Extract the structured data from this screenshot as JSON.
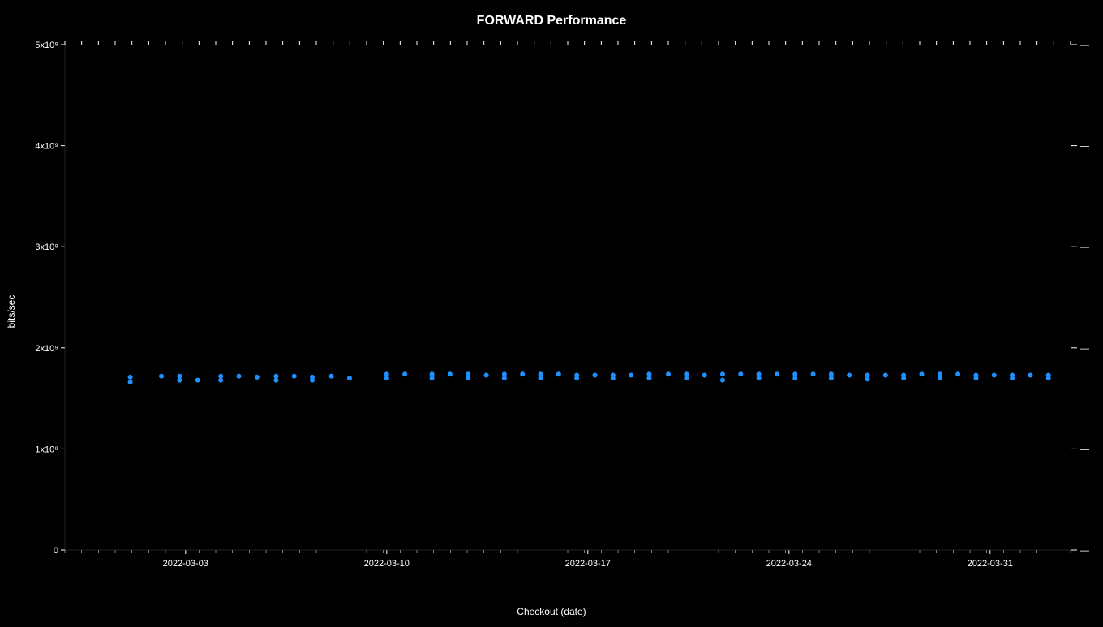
{
  "chart": {
    "title": "FORWARD Performance",
    "x_axis_label": "Checkout (date)",
    "y_axis_label": "bits/sec",
    "y_ticks": [
      {
        "label": "0",
        "value": 0
      },
      {
        "label": "1x10⁹",
        "value": 1
      },
      {
        "label": "2x10⁹",
        "value": 2
      },
      {
        "label": "3x10⁹",
        "value": 3
      },
      {
        "label": "4x10⁹",
        "value": 4
      },
      {
        "label": "5x10⁹",
        "value": 5
      }
    ],
    "x_ticks": [
      {
        "label": "2022-03-03",
        "xpos": 0.12
      },
      {
        "label": "2022-03-10",
        "xpos": 0.32
      },
      {
        "label": "2022-03-17",
        "xpos": 0.52
      },
      {
        "label": "2022-03-24",
        "xpos": 0.72
      },
      {
        "label": "2022-03-31",
        "xpos": 0.92
      }
    ],
    "data_color": "#1e90ff",
    "dot_groups": [
      {
        "x": 0.065,
        "dots": [
          {
            "y": 1.71
          },
          {
            "y": 1.66
          }
        ]
      },
      {
        "x": 0.096,
        "dots": [
          {
            "y": 1.72
          }
        ]
      },
      {
        "x": 0.114,
        "dots": [
          {
            "y": 1.72
          },
          {
            "y": 1.68
          }
        ]
      },
      {
        "x": 0.132,
        "dots": [
          {
            "y": 1.68
          }
        ]
      },
      {
        "x": 0.155,
        "dots": [
          {
            "y": 1.72
          },
          {
            "y": 1.68
          }
        ]
      },
      {
        "x": 0.173,
        "dots": [
          {
            "y": 1.72
          }
        ]
      },
      {
        "x": 0.191,
        "dots": [
          {
            "y": 1.71
          }
        ]
      },
      {
        "x": 0.21,
        "dots": [
          {
            "y": 1.72
          },
          {
            "y": 1.68
          }
        ]
      },
      {
        "x": 0.228,
        "dots": [
          {
            "y": 1.72
          }
        ]
      },
      {
        "x": 0.246,
        "dots": [
          {
            "y": 1.71
          },
          {
            "y": 1.68
          }
        ]
      },
      {
        "x": 0.265,
        "dots": [
          {
            "y": 1.72
          }
        ]
      },
      {
        "x": 0.283,
        "dots": [
          {
            "y": 1.7
          }
        ]
      },
      {
        "x": 0.32,
        "dots": [
          {
            "y": 1.74
          },
          {
            "y": 1.7
          }
        ]
      },
      {
        "x": 0.338,
        "dots": [
          {
            "y": 1.74
          }
        ]
      },
      {
        "x": 0.365,
        "dots": [
          {
            "y": 1.74
          },
          {
            "y": 1.7
          }
        ]
      },
      {
        "x": 0.383,
        "dots": [
          {
            "y": 1.74
          }
        ]
      },
      {
        "x": 0.401,
        "dots": [
          {
            "y": 1.74
          },
          {
            "y": 1.7
          }
        ]
      },
      {
        "x": 0.419,
        "dots": [
          {
            "y": 1.73
          }
        ]
      },
      {
        "x": 0.437,
        "dots": [
          {
            "y": 1.74
          },
          {
            "y": 1.7
          }
        ]
      },
      {
        "x": 0.455,
        "dots": [
          {
            "y": 1.74
          }
        ]
      },
      {
        "x": 0.473,
        "dots": [
          {
            "y": 1.74
          },
          {
            "y": 1.7
          }
        ]
      },
      {
        "x": 0.491,
        "dots": [
          {
            "y": 1.74
          }
        ]
      },
      {
        "x": 0.509,
        "dots": [
          {
            "y": 1.73
          },
          {
            "y": 1.7
          }
        ]
      },
      {
        "x": 0.527,
        "dots": [
          {
            "y": 1.73
          }
        ]
      },
      {
        "x": 0.545,
        "dots": [
          {
            "y": 1.73
          },
          {
            "y": 1.7
          }
        ]
      },
      {
        "x": 0.563,
        "dots": [
          {
            "y": 1.73
          }
        ]
      },
      {
        "x": 0.581,
        "dots": [
          {
            "y": 1.74
          },
          {
            "y": 1.7
          }
        ]
      },
      {
        "x": 0.6,
        "dots": [
          {
            "y": 1.74
          }
        ]
      },
      {
        "x": 0.618,
        "dots": [
          {
            "y": 1.74
          },
          {
            "y": 1.7
          }
        ]
      },
      {
        "x": 0.636,
        "dots": [
          {
            "y": 1.73
          }
        ]
      },
      {
        "x": 0.654,
        "dots": [
          {
            "y": 1.74
          },
          {
            "y": 1.68
          }
        ]
      },
      {
        "x": 0.672,
        "dots": [
          {
            "y": 1.74
          }
        ]
      },
      {
        "x": 0.69,
        "dots": [
          {
            "y": 1.74
          },
          {
            "y": 1.7
          }
        ]
      },
      {
        "x": 0.708,
        "dots": [
          {
            "y": 1.74
          }
        ]
      },
      {
        "x": 0.726,
        "dots": [
          {
            "y": 1.74
          },
          {
            "y": 1.7
          }
        ]
      },
      {
        "x": 0.744,
        "dots": [
          {
            "y": 1.74
          }
        ]
      },
      {
        "x": 0.762,
        "dots": [
          {
            "y": 1.74
          },
          {
            "y": 1.7
          }
        ]
      },
      {
        "x": 0.78,
        "dots": [
          {
            "y": 1.73
          }
        ]
      },
      {
        "x": 0.798,
        "dots": [
          {
            "y": 1.73
          },
          {
            "y": 1.69
          }
        ]
      },
      {
        "x": 0.816,
        "dots": [
          {
            "y": 1.73
          }
        ]
      },
      {
        "x": 0.834,
        "dots": [
          {
            "y": 1.73
          },
          {
            "y": 1.7
          }
        ]
      },
      {
        "x": 0.852,
        "dots": [
          {
            "y": 1.74
          }
        ]
      },
      {
        "x": 0.87,
        "dots": [
          {
            "y": 1.74
          },
          {
            "y": 1.7
          }
        ]
      },
      {
        "x": 0.888,
        "dots": [
          {
            "y": 1.74
          }
        ]
      },
      {
        "x": 0.906,
        "dots": [
          {
            "y": 1.73
          },
          {
            "y": 1.7
          }
        ]
      },
      {
        "x": 0.924,
        "dots": [
          {
            "y": 1.73
          }
        ]
      },
      {
        "x": 0.942,
        "dots": [
          {
            "y": 1.73
          },
          {
            "y": 1.7
          }
        ]
      },
      {
        "x": 0.96,
        "dots": [
          {
            "y": 1.73
          }
        ]
      },
      {
        "x": 0.978,
        "dots": [
          {
            "y": 1.73
          },
          {
            "y": 1.7
          }
        ]
      }
    ]
  }
}
